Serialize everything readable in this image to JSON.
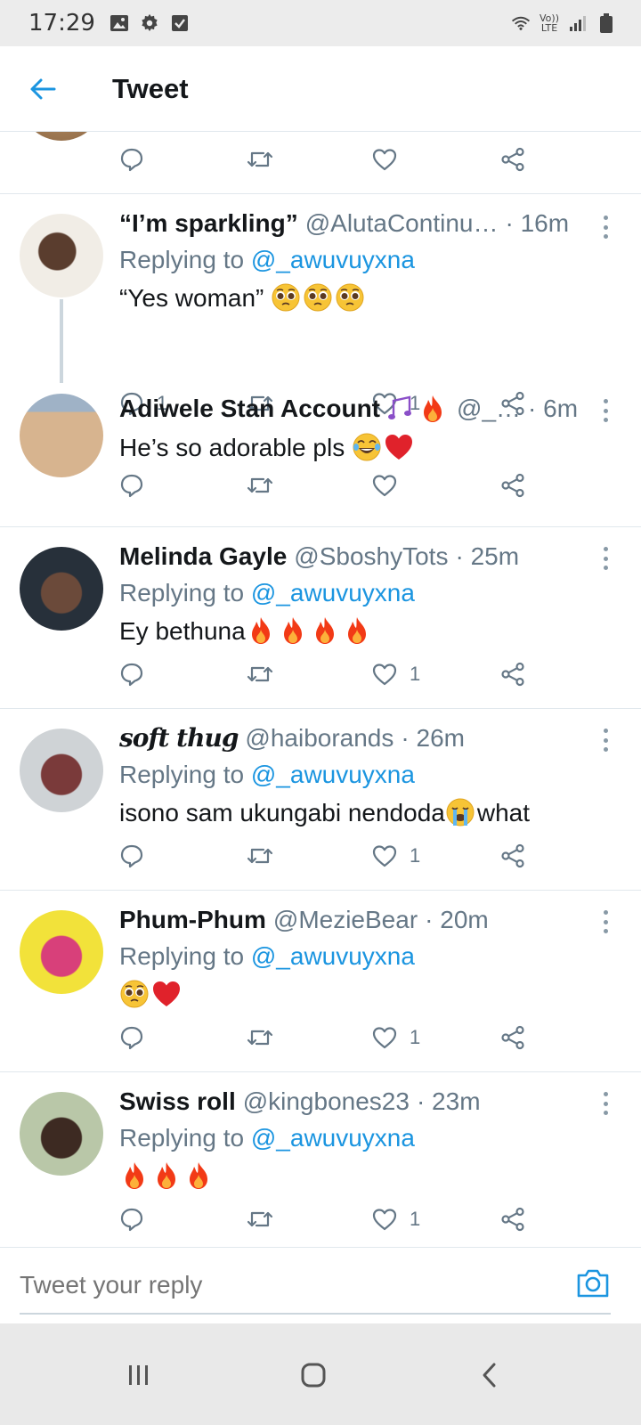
{
  "status_bar": {
    "time": "17:29",
    "volte_top": "Vo))",
    "volte_bottom": "LTE"
  },
  "header": {
    "title": "Tweet"
  },
  "reply_prefix": "Replying to ",
  "reply_mention": "@_awuvuyxna",
  "tweets": [
    {
      "name": "“I’m sparkling”",
      "handle": "@AlutaContinu…",
      "time": "· 16m",
      "text": "“Yes woman” ",
      "emoji": [
        "pleading",
        "pleading",
        "pleading"
      ],
      "reply_count": "1",
      "like_count": "1",
      "avatar_colors": [
        "#f1ede6",
        "#3b2a22"
      ]
    },
    {
      "name": "Adiwele Stan Account",
      "handle": "@_…",
      "time": "· 6m",
      "text": "He’s so adorable pls ",
      "emoji": [
        "joy",
        "heart"
      ],
      "reply_count": "",
      "like_count": "",
      "avatar_colors": [
        "#d8b48e",
        "#8b6a4e"
      ]
    },
    {
      "name": "Melinda Gayle",
      "handle": "@SboshyTots",
      "time": "· 25m",
      "text": "Ey bethuna",
      "emoji": [
        "fire",
        "fire",
        "fire",
        "fire"
      ],
      "reply_count": "",
      "like_count": "1",
      "avatar_colors": [
        "#27303a",
        "#6b4a3a"
      ]
    },
    {
      "name": "soft thug",
      "handle": "@haiborands",
      "time": "· 26m",
      "text": "isono sam ukungabi nendoda",
      "text_after": "what",
      "emoji": [
        "crying"
      ],
      "reply_count": "",
      "like_count": "1",
      "avatar_colors": [
        "#cfd3d6",
        "#7a3a3a"
      ]
    },
    {
      "name": "Phum-Phum",
      "handle": "@MezieBear",
      "time": "· 20m",
      "text": "",
      "emoji": [
        "pleading",
        "heart"
      ],
      "reply_count": "",
      "like_count": "1",
      "avatar_colors": [
        "#f2e23a",
        "#d8407a"
      ]
    },
    {
      "name": "Swiss roll",
      "handle": "@kingbones23",
      "time": "· 23m",
      "text": "",
      "emoji": [
        "fire",
        "fire",
        "fire"
      ],
      "reply_count": "",
      "like_count": "1",
      "avatar_colors": [
        "#b9c7a8",
        "#3d2a22"
      ]
    }
  ],
  "reply_bar": {
    "placeholder": "Tweet your reply"
  },
  "colors": {
    "accent": "#1b95e0",
    "secondary_text": "#657786",
    "divider": "#e1e8ed"
  },
  "icons": {
    "reply": "reply-bubble-icon",
    "retweet": "retweet-icon",
    "like": "heart-outline-icon",
    "share": "share-icon"
  }
}
